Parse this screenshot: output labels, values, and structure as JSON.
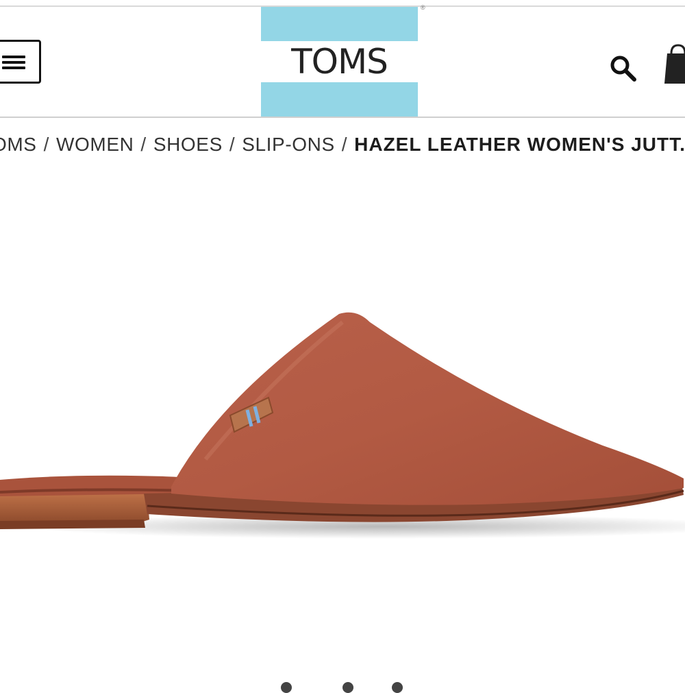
{
  "header": {
    "logo_text": "TOMS",
    "logo_registered": "®",
    "logo_stripe_color": "#93d6e6",
    "menu_icon": "hamburger-menu-icon",
    "search_icon": "search-icon",
    "bag_icon": "shopping-bag-icon"
  },
  "breadcrumb": {
    "items": [
      "OMS",
      "WOMEN",
      "SHOES",
      "SLIP-ONS"
    ],
    "separator": "/",
    "current": "HAZEL LEATHER WOMEN'S JUTT..."
  },
  "product": {
    "image_icon": "slip-on-mule-shoe-image",
    "leather_color": "#b0553e",
    "tab_stripe_color": "#7fb0e0"
  },
  "carousel": {
    "dot_icon": "carousel-dot-icon"
  }
}
